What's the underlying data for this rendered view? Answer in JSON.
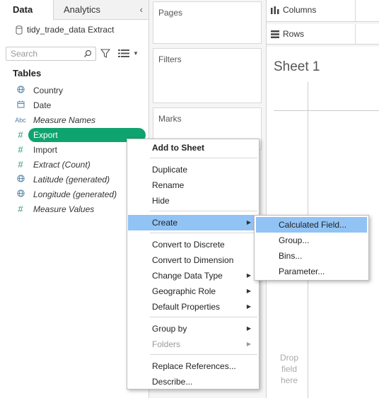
{
  "tabs": {
    "data": "Data",
    "analytics": "Analytics"
  },
  "datasource": {
    "name": "tidy_trade_data Extract"
  },
  "search": {
    "placeholder": "Search"
  },
  "tables_heading": "Tables",
  "fields": [
    {
      "icon": "globe-icon",
      "prefix": "",
      "label": "Country",
      "italic": false
    },
    {
      "icon": "calendar-icon",
      "prefix": "",
      "label": "Date",
      "italic": false
    },
    {
      "icon": "abc-icon",
      "prefix": "Abc",
      "label": "Measure Names",
      "italic": true
    },
    {
      "icon": "hash-icon",
      "prefix": "#",
      "label": "Export",
      "italic": false,
      "selected": true
    },
    {
      "icon": "hash-icon",
      "prefix": "#",
      "label": "Import",
      "italic": false
    },
    {
      "icon": "hash-icon",
      "prefix": "#",
      "label": "Extract (Count)",
      "italic": true
    },
    {
      "icon": "globe-icon",
      "prefix": "",
      "label": "Latitude (generated)",
      "italic": true
    },
    {
      "icon": "globe-icon",
      "prefix": "",
      "label": "Longitude (generated)",
      "italic": true
    },
    {
      "icon": "hash-icon",
      "prefix": "#",
      "label": "Measure Values",
      "italic": true
    }
  ],
  "cards": {
    "pages": "Pages",
    "filters": "Filters",
    "marks": "Marks"
  },
  "shelves": {
    "columns": "Columns",
    "rows": "Rows"
  },
  "sheet": {
    "title": "Sheet 1",
    "drop_line1": "Drop",
    "drop_line2": "field",
    "drop_line3": "here"
  },
  "context_menu": {
    "items": [
      {
        "label": "Add to Sheet"
      },
      {
        "label": "Duplicate"
      },
      {
        "label": "Rename"
      },
      {
        "label": "Hide"
      },
      {
        "label": "Create"
      },
      {
        "label": "Convert to Discrete"
      },
      {
        "label": "Convert to Dimension"
      },
      {
        "label": "Change Data Type"
      },
      {
        "label": "Geographic Role"
      },
      {
        "label": "Default Properties"
      },
      {
        "label": "Group by"
      },
      {
        "label": "Folders"
      },
      {
        "label": "Replace References..."
      },
      {
        "label": "Describe..."
      }
    ]
  },
  "create_submenu": {
    "items": [
      {
        "label": "Calculated Field..."
      },
      {
        "label": "Group..."
      },
      {
        "label": "Bins..."
      },
      {
        "label": "Parameter..."
      }
    ]
  },
  "colors": {
    "accent_green": "#0fa370",
    "menu_highlight": "#91c3f5"
  }
}
